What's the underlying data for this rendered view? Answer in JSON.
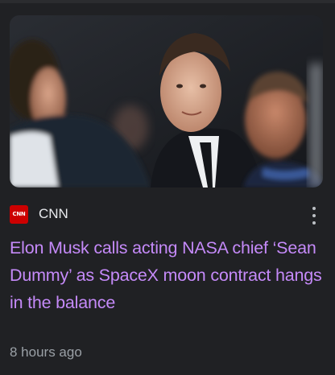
{
  "article": {
    "source": {
      "logo_text": "CNN",
      "name": "CNN",
      "logo_color": "#cc0000"
    },
    "headline": "Elon Musk calls acting NASA chief ‘Sean Dummy’ as SpaceX moon contract hangs in the balance",
    "timestamp": "8 hours ago",
    "more_icon": "more-vert-icon",
    "colors": {
      "background": "#202124",
      "headline": "#c58af9",
      "meta_text": "#9aa0a6"
    }
  }
}
